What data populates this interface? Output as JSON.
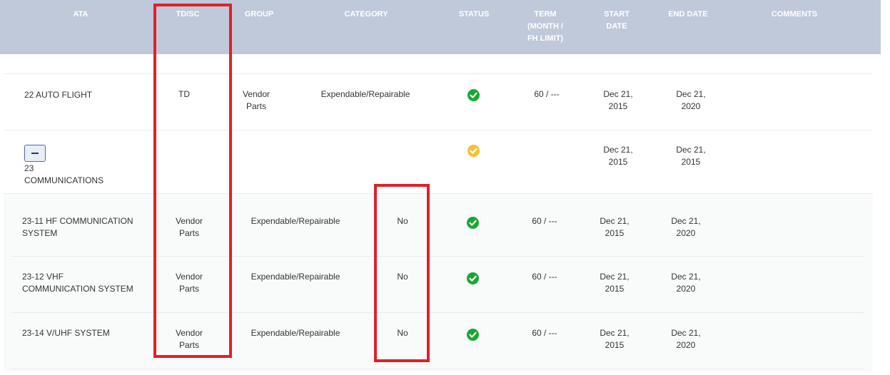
{
  "header": {
    "ata": "ATA",
    "tdsc": "TD/SC",
    "group": "GROUP",
    "category": "CATEGORY",
    "status": "STATUS",
    "term": "TERM\n(MONTH /\nFH LIMIT)",
    "start_date": "START\nDATE",
    "end_date": "END DATE",
    "comments": "COMMENTS"
  },
  "rows": [
    {
      "ata": "22 AUTO FLIGHT",
      "tdsc": "TD",
      "group": "Vendor\nParts",
      "category": "Expendable/Repairable",
      "status": "ok",
      "term": "60 / ---",
      "start_date": "Dec 21,\n2015",
      "end_date": "Dec 21,\n2020"
    },
    {
      "ata": "23\nCOMMUNICATIONS",
      "toggle": "−",
      "status": "partial",
      "start_date": "Dec 21,\n2015",
      "end_date": "Dec 21,\n2015"
    },
    {
      "ata": "23-11 HF COMMUNICATION\nSYSTEM",
      "tdsc": "Vendor\nParts",
      "group": "Expendable/Repairable",
      "category": "No",
      "status": "ok",
      "term": "60 / ---",
      "start_date": "Dec 21,\n2015",
      "end_date": "Dec 21,\n2020"
    },
    {
      "ata": "23-12 VHF\nCOMMUNICATION SYSTEM",
      "tdsc": "Vendor\nParts",
      "group": "Expendable/Repairable",
      "category": "No",
      "status": "ok",
      "term": "60 / ---",
      "start_date": "Dec 21,\n2015",
      "end_date": "Dec 21,\n2020"
    },
    {
      "ata": "23-14 V/UHF SYSTEM",
      "tdsc": "Vendor\nParts",
      "group": "Expendable/Repairable",
      "category": "No",
      "status": "ok",
      "term": "60 / ---",
      "start_date": "Dec 21,\n2015",
      "end_date": "Dec 21,\n2020"
    }
  ],
  "colors": {
    "header_bg": "#c0c9d9",
    "ok": "#18a832",
    "partial": "#f2c230",
    "highlight": "#e0202a"
  },
  "icons": {
    "ok": "check-circle-icon",
    "partial": "check-circle-icon",
    "toggle": "minus-icon"
  }
}
